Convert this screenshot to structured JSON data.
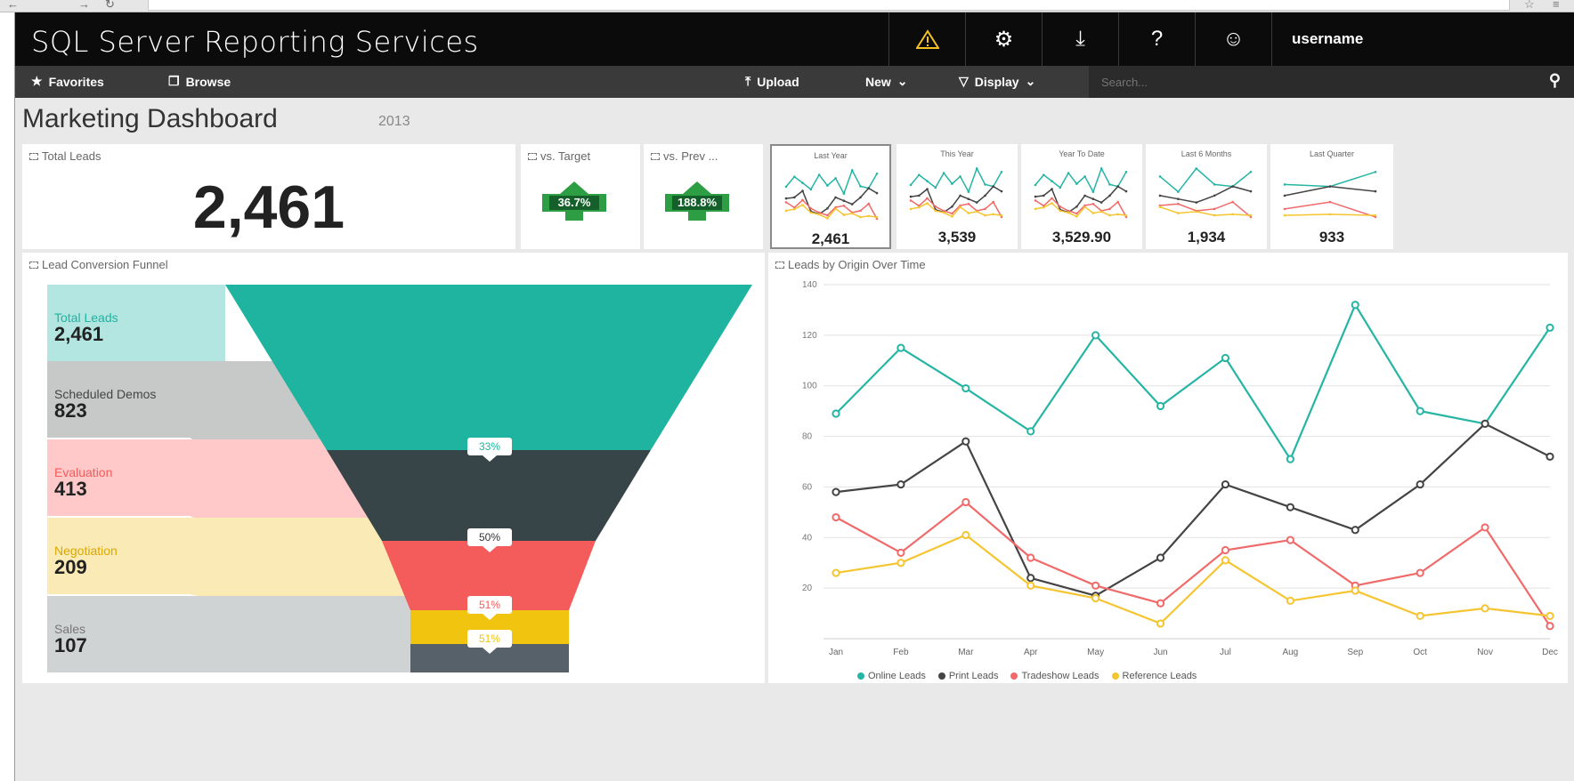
{
  "app": {
    "title": "SQL Server Reporting Services",
    "username": "username",
    "icons": [
      "warning-icon",
      "gear-icon",
      "download-icon",
      "help-icon",
      "smiley-icon"
    ]
  },
  "toolbar": {
    "favorites": "Favorites",
    "browse": "Browse",
    "upload": "Upload",
    "new": "New",
    "display": "Display",
    "search_placeholder": "Search..."
  },
  "page": {
    "title": "Marketing Dashboard",
    "year": "2013"
  },
  "kpis": {
    "total_leads_label": "Total Leads",
    "total_leads_value": "2,461",
    "vs_target_label": "vs. Target",
    "vs_target_value": "36.7%",
    "vs_prev_label": "vs. Prev ...",
    "vs_prev_value": "188.8%"
  },
  "sparklines": [
    {
      "title": "Last Year",
      "value": "2,461",
      "selected": true
    },
    {
      "title": "This Year",
      "value": "3,539",
      "selected": false
    },
    {
      "title": "Year To Date",
      "value": "3,529.90",
      "selected": false
    },
    {
      "title": "Last 6 Months",
      "value": "1,934",
      "selected": false
    },
    {
      "title": "Last Quarter",
      "value": "933",
      "selected": false
    }
  ],
  "funnel": {
    "title": "Lead Conversion Funnel",
    "stages": [
      {
        "label": "Total Leads",
        "value": "2,461",
        "light": "#b3e5e1",
        "dark": "#1eb4a0",
        "labelColor": "#1eb4a0"
      },
      {
        "label": "Scheduled Demos",
        "value": "823",
        "light": "#c7c9c9",
        "dark": "#384548",
        "labelColor": "#444444"
      },
      {
        "label": "Evaluation",
        "value": "413",
        "light": "#ffc9c9",
        "dark": "#f45b5b",
        "labelColor": "#f45b5b"
      },
      {
        "label": "Negotiation",
        "value": "209",
        "light": "#faeab6",
        "dark": "#f1c40f",
        "labelColor": "#d9a800"
      },
      {
        "label": "Sales",
        "value": "107",
        "light": "#d0d3d4",
        "dark": "#56616a",
        "labelColor": "#777777"
      }
    ],
    "conversions": [
      {
        "text": "33%",
        "color": "#1eb4a0"
      },
      {
        "text": "50%",
        "color": "#333333"
      },
      {
        "text": "51%",
        "color": "#f45b5b"
      },
      {
        "text": "51%",
        "color": "#f1c40f"
      }
    ]
  },
  "chart_data": {
    "type": "line",
    "title": "Leads by Origin Over Time",
    "xlabel": "",
    "ylabel": "",
    "categories": [
      "Jan",
      "Feb",
      "Mar",
      "Apr",
      "May",
      "Jun",
      "Jul",
      "Aug",
      "Sep",
      "Oct",
      "Nov",
      "Dec"
    ],
    "ylim": [
      0,
      140
    ],
    "yticks": [
      20,
      40,
      60,
      80,
      100,
      120,
      140
    ],
    "grid": true,
    "legend": "bottom",
    "series": [
      {
        "name": "Online Leads",
        "color": "#26b5a4",
        "values": [
          89,
          115,
          99,
          82,
          120,
          92,
          111,
          71,
          132,
          90,
          85,
          123
        ]
      },
      {
        "name": "Print Leads",
        "color": "#444444",
        "values": [
          58,
          61,
          78,
          24,
          17,
          32,
          61,
          52,
          43,
          61,
          85,
          72
        ]
      },
      {
        "name": "Tradeshow Leads",
        "color": "#f06a6a",
        "values": [
          48,
          34,
          54,
          32,
          21,
          14,
          35,
          39,
          21,
          26,
          44,
          5
        ]
      },
      {
        "name": "Reference Leads",
        "color": "#f5c531",
        "values": [
          26,
          30,
          41,
          21,
          16,
          6,
          31,
          15,
          19,
          9,
          12,
          9
        ]
      }
    ]
  }
}
